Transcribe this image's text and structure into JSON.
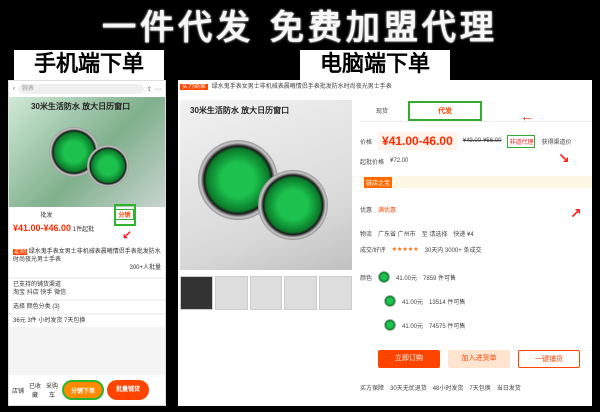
{
  "header": {
    "title": "一件代发 免费加盟代理"
  },
  "labels": {
    "mobile": "手机端下单",
    "pc": "电脑端下单"
  },
  "mobile": {
    "search": "腕表",
    "banner": "30米生活防水 放大日历窗口",
    "tabs": [
      "批发",
      "分销"
    ],
    "price": "¥41.00-¥46.00",
    "price_unit": "1件起批",
    "tag": "定制",
    "title": "绿水鬼手表女男士非机械表晨曦情侣手表批发防水时尚夜光男士手表",
    "sales": "300+人批量",
    "sec1": "已支持的铺货渠道",
    "channels": [
      "淘宝",
      "抖店",
      "快手",
      "微信"
    ],
    "sec2": "选择 颜色分类 (3)",
    "service": "36元 3件 小时发货 7天包换",
    "bar": {
      "shop": "店铺",
      "fav": "已收藏",
      "cart": "采购车",
      "distribute": "分销下单",
      "bulk": "批量铺货"
    }
  },
  "pc": {
    "badge": "实力商家",
    "title": "绿水鬼手表女男士非机械表晨曦情侣手表批发防水时尚夜光男士手表",
    "banner": "30米生活防水 放大日历窗口",
    "tabs": [
      "现货",
      "代发"
    ],
    "price_label": "价格",
    "price": "¥41.00-46.00",
    "old_price": "¥49.00-¥56.00",
    "agent": "非道代理",
    "agent_note": "获得渠道价",
    "min_label": "起批价格",
    "min_value": "¥72.00",
    "shop": "链店之宝",
    "promo_label": "优惠",
    "promo": "满优惠",
    "ship_label": "物流",
    "ship_from": "广东省 广州市",
    "ship_to": "至 请选择",
    "ship_fee": "快递 ¥4",
    "rating_label": "成交/好评",
    "rating": "★★★★★",
    "sales": "30天内 3000+ 条成交",
    "sku_label": "颜色",
    "skus": [
      {
        "price": "41.00元",
        "stock": "7859 件可售"
      },
      {
        "price": "41.00元",
        "stock": "13514 件可售"
      },
      {
        "price": "41.00元",
        "stock": "74575 件可售"
      }
    ],
    "buttons": {
      "order": "立即订购",
      "cart": "加入进货单",
      "distribute": "一键铺货"
    },
    "service_label": "买方保障",
    "service": [
      "30天无忧退货",
      "48小时发货",
      "7天包换",
      "当日发货"
    ]
  },
  "colors": {
    "orange": "#ff4400",
    "green": "#2db52d",
    "red": "#ff1a1a"
  }
}
